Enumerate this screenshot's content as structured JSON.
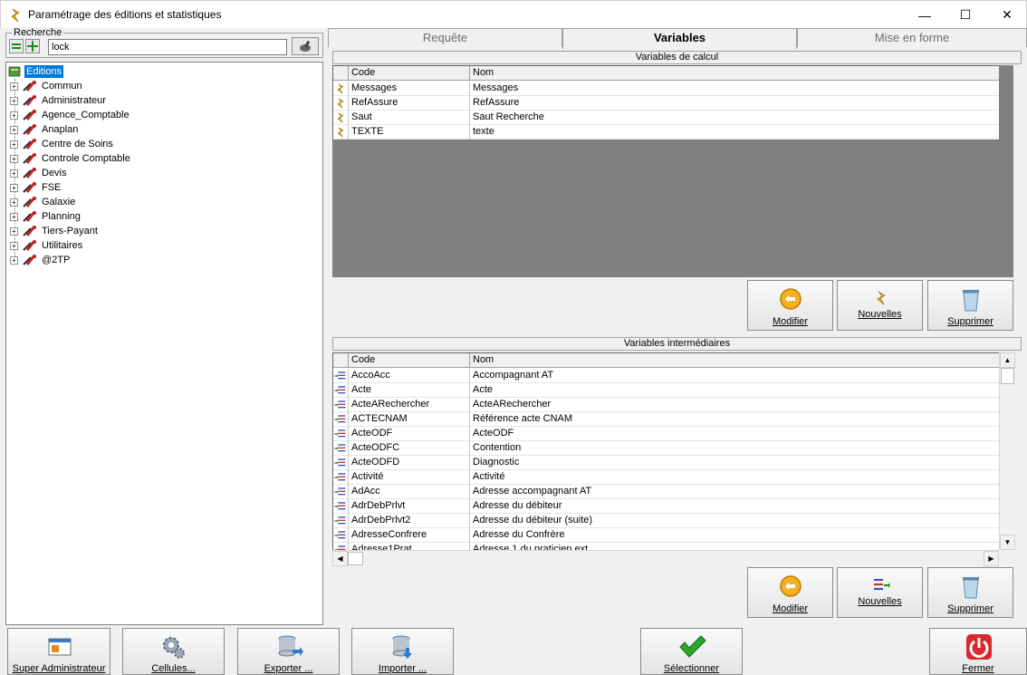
{
  "window": {
    "title": "Paramétrage des éditions et statistiques",
    "minimize_glyph": "—",
    "maximize_glyph": "☐",
    "close_glyph": "✕"
  },
  "search": {
    "legend": "Recherche",
    "value": "lock"
  },
  "tree": {
    "root": "Editions",
    "nodes": [
      "Commun",
      "Administrateur",
      "Agence_Comptable",
      "Anaplan",
      "Centre de Soins",
      "Controle Comptable",
      "Devis",
      "FSE",
      "Galaxie",
      "Planning",
      "Tiers-Payant",
      "Utilitaires",
      "@2TP"
    ]
  },
  "tabs": [
    "Requête",
    "Variables",
    "Mise en forme"
  ],
  "calc": {
    "title": "Variables de calcul",
    "col_code": "Code",
    "col_nom": "Nom",
    "rows": [
      {
        "code": "Messages",
        "nom": "Messages"
      },
      {
        "code": "RefAssure",
        "nom": "RefAssure"
      },
      {
        "code": "Saut",
        "nom": "Saut Recherche"
      },
      {
        "code": "TEXTE",
        "nom": "texte"
      }
    ],
    "buttons": {
      "modifier": "Modifier",
      "nouvelles": "Nouvelles",
      "supprimer": "Supprimer"
    }
  },
  "inter": {
    "title": "Variables intermédiaires",
    "col_code": "Code",
    "col_nom": "Nom",
    "rows": [
      {
        "code": "AccoAcc",
        "nom": "Accompagnant AT"
      },
      {
        "code": "Acte",
        "nom": "Acte"
      },
      {
        "code": "ActeARechercher",
        "nom": "ActeARechercher"
      },
      {
        "code": "ACTECNAM",
        "nom": "Référence acte CNAM"
      },
      {
        "code": "ActeODF",
        "nom": "ActeODF"
      },
      {
        "code": "ActeODFC",
        "nom": "Contention"
      },
      {
        "code": "ActeODFD",
        "nom": "Diagnostic"
      },
      {
        "code": "Activité",
        "nom": "Activité"
      },
      {
        "code": "AdAcc",
        "nom": "Adresse accompagnant AT"
      },
      {
        "code": "AdrDebPrlvt",
        "nom": "Adresse du débiteur"
      },
      {
        "code": "AdrDebPrlvt2",
        "nom": "Adresse du débiteur (suite)"
      },
      {
        "code": "AdresseConfrere",
        "nom": "Adresse du Confrère"
      },
      {
        "code": "Adresse1Prat",
        "nom": "Adresse 1 du praticien ext"
      }
    ],
    "buttons": {
      "modifier": "Modifier",
      "nouvelles": "Nouvelles",
      "supprimer": "Supprimer"
    }
  },
  "bottom": {
    "super_admin": "Super Administrateur",
    "cellules": "Cellules...",
    "exporter": "Exporter ...",
    "importer": "Importer ...",
    "selectionner": "Sélectionner",
    "fermer": "Fermer"
  },
  "colors": {
    "selection": "#0078d7",
    "grid_background": "#808080",
    "accent_green": "#2a9d2a",
    "close_red": "#d92a2a"
  }
}
